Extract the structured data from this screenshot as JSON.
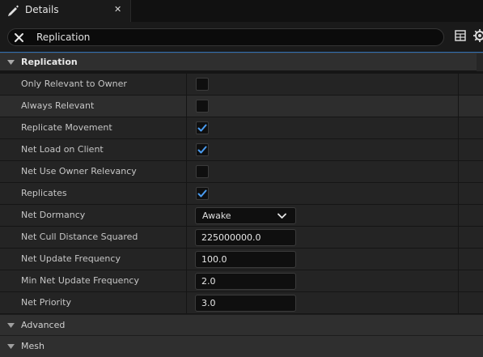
{
  "tab": {
    "title": "Details",
    "close_glyph": "✕"
  },
  "search": {
    "value": "Replication",
    "placeholder": "Search"
  },
  "section": {
    "label": "Replication"
  },
  "properties": [
    {
      "name": "Only Relevant to Owner",
      "type": "checkbox",
      "checked": false
    },
    {
      "name": "Always Relevant",
      "type": "checkbox",
      "checked": false
    },
    {
      "name": "Replicate Movement",
      "type": "checkbox",
      "checked": true
    },
    {
      "name": "Net Load on Client",
      "type": "checkbox",
      "checked": true
    },
    {
      "name": "Net Use Owner Relevancy",
      "type": "checkbox",
      "checked": false
    },
    {
      "name": "Replicates",
      "type": "checkbox",
      "checked": true
    },
    {
      "name": "Net Dormancy",
      "type": "dropdown",
      "value": "Awake"
    },
    {
      "name": "Net Cull Distance Squared",
      "type": "number",
      "value": "225000000.0"
    },
    {
      "name": "Net Update Frequency",
      "type": "number",
      "value": "100.0"
    },
    {
      "name": "Min Net Update Frequency",
      "type": "number",
      "value": "2.0"
    },
    {
      "name": "Net Priority",
      "type": "number",
      "value": "3.0"
    }
  ],
  "collapsed_sections": [
    {
      "label": "Advanced"
    },
    {
      "label": "Mesh"
    }
  ],
  "icons": {
    "tab": "pen-icon",
    "clear": "close-icon",
    "view": "table-icon",
    "settings": "gear-icon",
    "expand": "triangle-down-icon",
    "check": "checkmark-icon",
    "dropdown": "chevron-down-icon"
  },
  "colors": {
    "accent": "#2f6fb3",
    "check": "#4a9cf0",
    "panel_bg": "#242424",
    "header_bg": "#2f2f2f"
  }
}
